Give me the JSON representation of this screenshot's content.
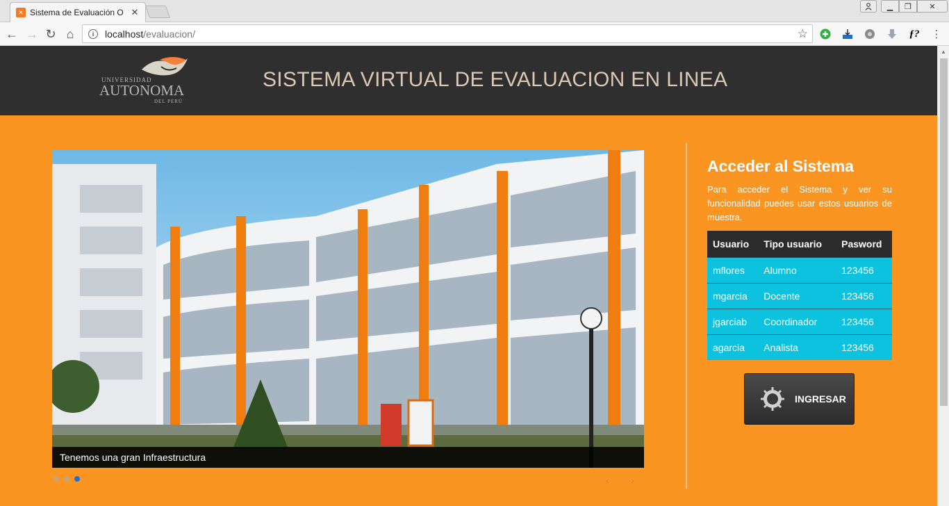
{
  "browser": {
    "tab_title": "Sistema de Evaluación O",
    "url_host": "localhost",
    "url_path": "/evaluacion/"
  },
  "header": {
    "logo_line1": "UNIVERSIDAD",
    "logo_line2": "AUTONOMA",
    "logo_line3": "DEL PERÚ",
    "title": "SISTEMA VIRTUAL DE EVALUACION EN LINEA"
  },
  "carousel": {
    "caption": "Tenemos una gran Infraestructura",
    "slides": 3,
    "active_slide": 3
  },
  "access": {
    "title": "Acceder al Sistema",
    "description": "Para acceder el Sistema y ver su funcionalidad puedes usar estos usuarios de muestra.",
    "columns": [
      "Usuario",
      "Tipo usuario",
      "Pasword"
    ],
    "rows": [
      [
        "mflores",
        "Alumno",
        "123456"
      ],
      [
        "mgarcia",
        "Docente",
        "123456"
      ],
      [
        "jgarciab",
        "Coordinador",
        "123456"
      ],
      [
        "agarcia",
        "Analista",
        "123456"
      ]
    ],
    "button_label": "INGRESAR"
  },
  "colors": {
    "page_bg": "#fb9521",
    "header_bg": "#2f2f2f",
    "table_row": "#0cc2df",
    "table_head": "#2b2b2b"
  }
}
